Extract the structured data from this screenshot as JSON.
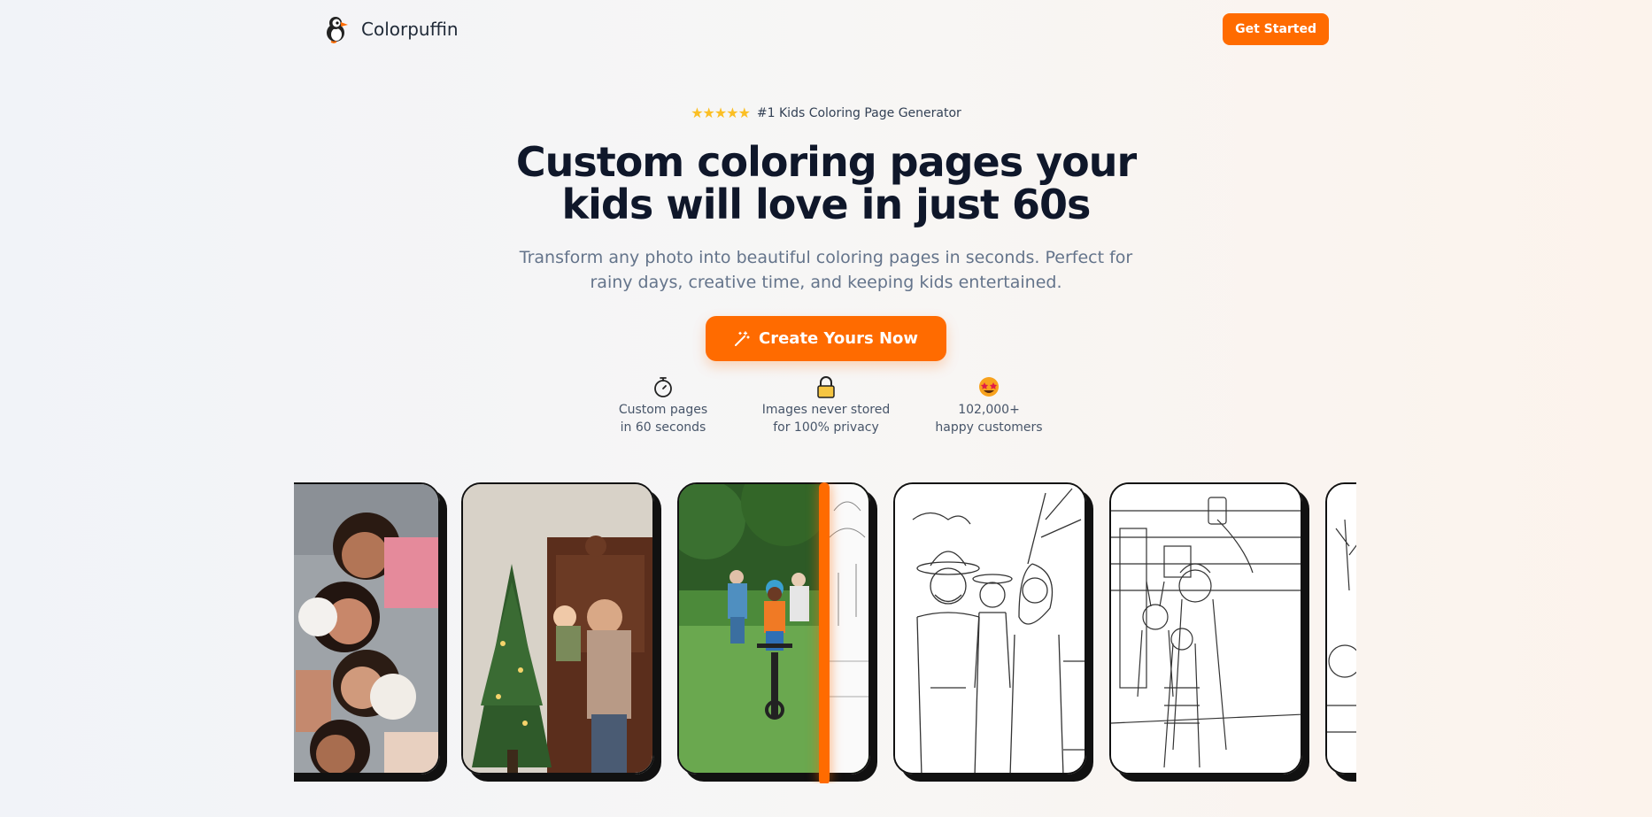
{
  "header": {
    "brand_name": "Colorpuffin",
    "logo_icon": "puffin-logo",
    "cta_label": "Get Started"
  },
  "hero": {
    "rating_stars": 5,
    "rating_text": "#1 Kids Coloring Page Generator",
    "headline_line1": "Custom coloring pages your",
    "headline_line2": "kids will love in just 60s",
    "subline_line1": "Transform any photo into beautiful coloring pages in seconds. Perfect for",
    "subline_line2": "rainy days, creative time, and keeping kids entertained.",
    "cta_label": "Create Yours Now",
    "cta_icon": "magic-wand-icon"
  },
  "features": [
    {
      "icon": "stopwatch-icon",
      "line1": "Custom pages",
      "line2": "in 60 seconds"
    },
    {
      "icon": "lock-icon",
      "line1": "Images never stored",
      "line2": "for 100% privacy"
    },
    {
      "icon": "star-struck-emoji-icon",
      "line1": "102,000+",
      "line2": "happy customers"
    }
  ],
  "gallery": {
    "cards": [
      "family-photo",
      "christmas-tree-photo",
      "bike-photo-comparison",
      "cowboy-family-coloring-page",
      "selfie-family-coloring-page",
      "tree-coloring-page"
    ]
  },
  "colors": {
    "accent": "#ff6b00",
    "headline": "#0f172a",
    "muted": "#64748b",
    "star": "#fbbf24"
  }
}
